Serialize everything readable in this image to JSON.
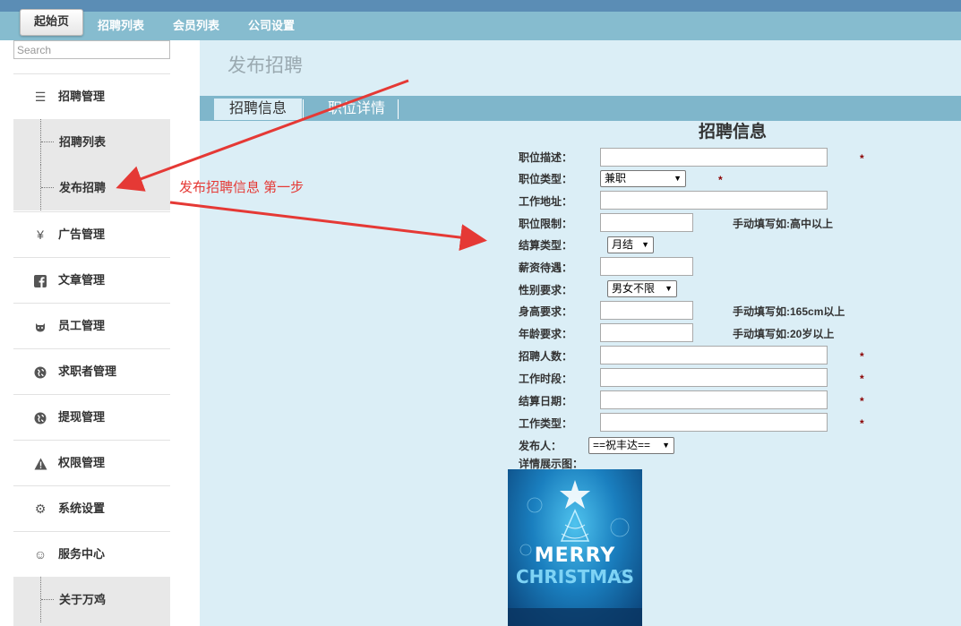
{
  "topnav": {
    "home": "起始页",
    "items": [
      "招聘列表",
      "会员列表",
      "公司设置"
    ]
  },
  "sidebar": {
    "search_placeholder": "Search",
    "menu": [
      {
        "label": "招聘管理",
        "icon": "list-icon"
      },
      {
        "label": "招聘列表",
        "sub": true
      },
      {
        "label": "发布招聘",
        "sub": true
      },
      {
        "label": "广告管理",
        "icon": "yen-icon"
      },
      {
        "label": "文章管理",
        "icon": "facebook-icon"
      },
      {
        "label": "员工管理",
        "icon": "github-icon"
      },
      {
        "label": "求职者管理",
        "icon": "globe-icon"
      },
      {
        "label": "提现管理",
        "icon": "globe-icon"
      },
      {
        "label": "权限管理",
        "icon": "warning-icon"
      },
      {
        "label": "系统设置",
        "icon": "gear-icon"
      },
      {
        "label": "服务中心",
        "icon": "smile-icon"
      },
      {
        "label": "关于万鸡",
        "sub": true
      }
    ]
  },
  "main": {
    "page_title": "发布招聘",
    "tabs": [
      "招聘信息",
      "职位详情"
    ],
    "form_title": "招聘信息",
    "fields": {
      "desc": "职位描述：",
      "type": "职位类型：",
      "address": "工作地址：",
      "limit": "职位限制：",
      "settle_type": "结算类型：",
      "salary": "薪资待遇：",
      "gender": "性别要求：",
      "height": "身高要求：",
      "age": "年龄要求：",
      "count": "招聘人数：",
      "period": "工作时段：",
      "settle_date": "结算日期：",
      "work_type": "工作类型：",
      "publisher": "发布人：",
      "image": "详情展示图："
    },
    "selects": {
      "type": "兼职",
      "settle_type": "月结",
      "gender": "男女不限",
      "publisher": "==祝丰达=="
    },
    "hints": {
      "limit": "手动填写如:高中以上",
      "height": "手动填写如:165cm以上",
      "age": "手动填写如:20岁以上"
    },
    "required_mark": "*",
    "poster": {
      "line1": "MERRY",
      "line2": "CHRISTMAS"
    }
  },
  "annotation": "发布招聘信息 第一步",
  "colors": {
    "accent": "#86bccf",
    "content_bg": "#dbeef6",
    "arrow": "#e53935"
  }
}
